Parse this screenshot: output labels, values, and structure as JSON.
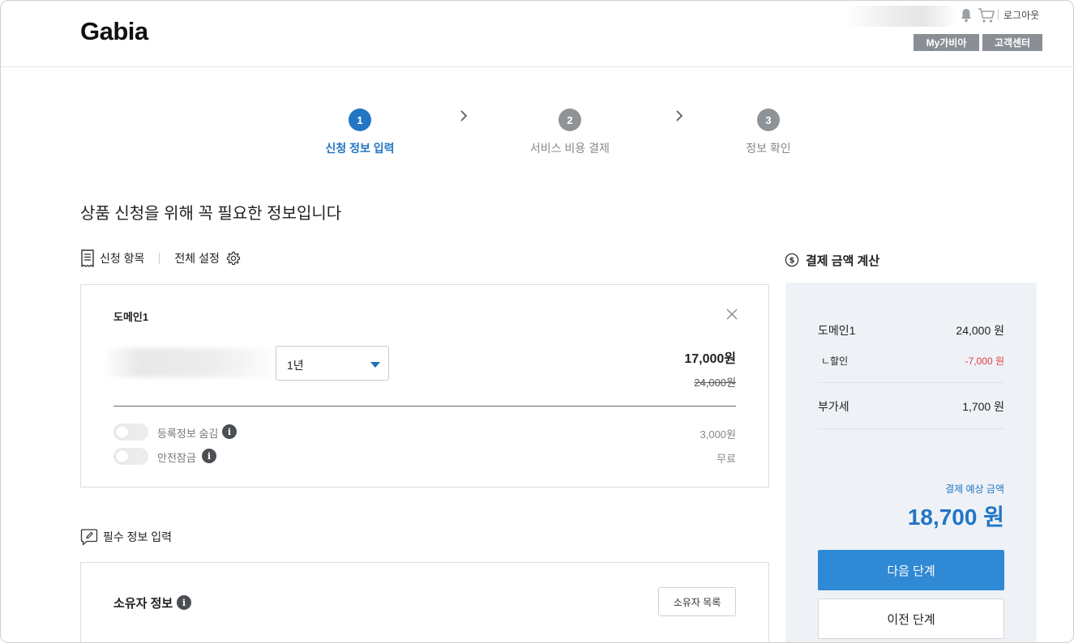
{
  "header": {
    "logo": "Gabia",
    "logout_label": "로그아웃",
    "my_label": "My가비아",
    "support_label": "고객센터"
  },
  "steps": [
    {
      "number": "1",
      "label": "신청 정보 입력",
      "active": true
    },
    {
      "number": "2",
      "label": "서비스 비용 결제",
      "active": false
    },
    {
      "number": "3",
      "label": "정보 확인",
      "active": false
    }
  ],
  "page_title": "상품 신청을 위해 꼭 필요한 정보입니다",
  "tools": {
    "items_label": "신청 항목",
    "settings_label": "전체 설정"
  },
  "domain_card": {
    "title": "도메인1",
    "period_value": "1년",
    "price": "17,000원",
    "original_price": "24,000원",
    "options": [
      {
        "label": "등록정보 숨김",
        "price": "3,000원"
      },
      {
        "label": "안전잠금",
        "price": "무료"
      }
    ]
  },
  "required": {
    "section_label": "필수 정보 입력",
    "owner_title": "소유자 정보",
    "owner_list_button": "소유자 목록"
  },
  "payment": {
    "heading": "결제 금액 계산",
    "rows": {
      "domain_label": "도메인1",
      "domain_value": "24,000 원",
      "discount_label": "ㄴ할인",
      "discount_value": "-7,000 원",
      "vat_label": "부가세",
      "vat_value": "1,700 원"
    },
    "estimate_label": "결제 예상 금액",
    "estimate_value": "18,700 원",
    "next_button": "다음 단계",
    "prev_button": "이전 단계"
  },
  "colors": {
    "accent": "#2276c4",
    "primary_button": "#2f89d4",
    "discount": "#e23b3b",
    "panel_bg": "#eef2f7"
  }
}
